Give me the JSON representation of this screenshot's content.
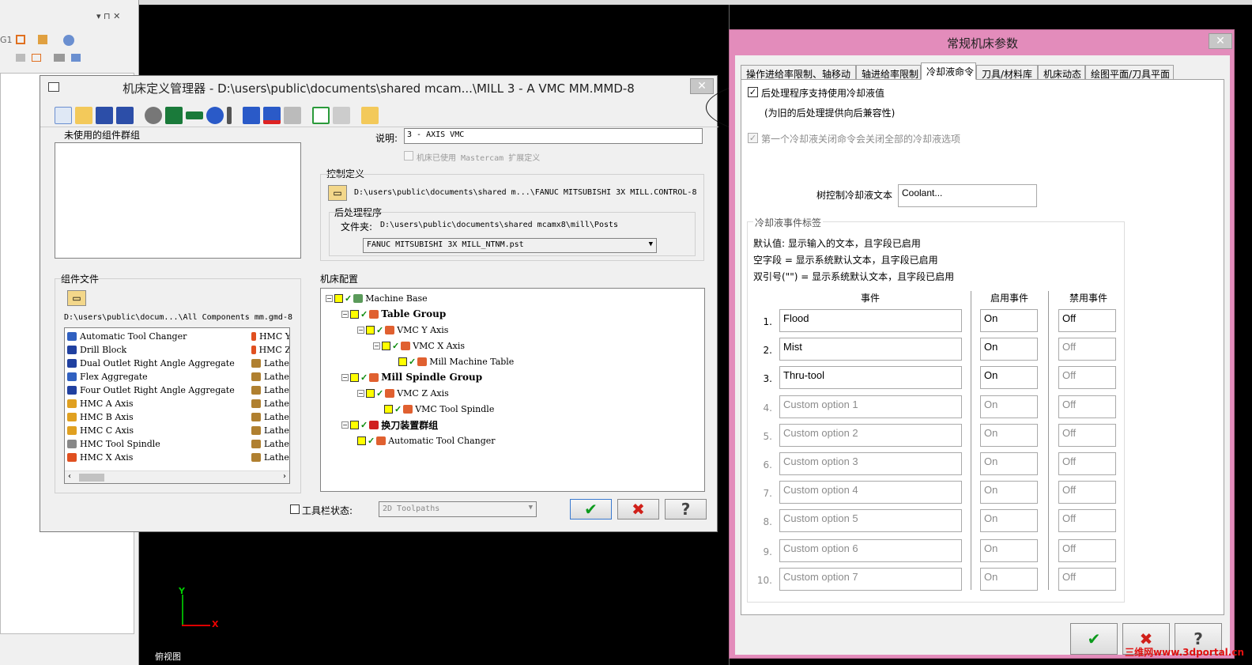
{
  "bg_left": {
    "tools_row1": "G1",
    "bottom_view_label": "俯视图",
    "axis_x": "X",
    "axis_y": "Y"
  },
  "manager": {
    "title": "机床定义管理器 - D:\\users\\public\\documents\\shared mcam...\\MILL 3 - A VMC MM.MMD-8",
    "unused_groups_label": "未使用的组件群组",
    "desc_label": "说明:",
    "desc_value": "3 - AXIS VMC",
    "ext_def_label": "机床已使用 Mastercam 扩展定义",
    "control_def_label": "控制定义",
    "control_path": "D:\\users\\public\\documents\\shared m...\\FANUC MITSUBISHI 3X MILL.CONTROL-8",
    "post_label": "后处理程序",
    "folder_label": "文件夹:",
    "folder_path": "D:\\users\\public\\documents\\shared mcamx8\\mill\\Posts",
    "post_select": "FANUC MITSUBISHI 3X MILL_NTNM.pst",
    "component_file_label": "组件文件",
    "component_path": "D:\\users\\public\\docum...\\All Components mm.gmd-8",
    "components_left": [
      "Automatic Tool Changer",
      "Drill Block",
      "Dual Outlet Right Angle Aggregate",
      "Flex Aggregate",
      "Four Outlet Right Angle Aggregate",
      "HMC A Axis",
      "HMC B Axis",
      "HMC C Axis",
      "HMC Tool Spindle",
      "HMC X Axis"
    ],
    "components_right": [
      "HMC Y",
      "HMC Z",
      "Lathe",
      "Lathe",
      "Lathe",
      "Lathe",
      "Lathe",
      "Lathe",
      "Lathe",
      "Lathe"
    ],
    "machine_config_label": "机床配置",
    "tree": [
      "Machine Base",
      "Table Group",
      "VMC Y Axis",
      "VMC X Axis",
      "Mill Machine Table",
      "Mill Spindle Group",
      "VMC Z Axis",
      "VMC Tool Spindle",
      "换刀装置群组",
      "Automatic Tool Changer"
    ],
    "toolbar_state_label": "工具栏状态:",
    "toolbar_state_value": "2D Toolpaths",
    "close_glyph": "✕",
    "ok_glyph": "✔",
    "cancel_glyph": "✖",
    "help_glyph": "?"
  },
  "dialog": {
    "title": "常规机床参数",
    "close_glyph": "✕",
    "tabs": [
      "操作进给率限制、轴移动",
      "轴进给率限制",
      "冷却液命令",
      "刀具/材料库",
      "机床动态",
      "绘图平面/刀具平面"
    ],
    "active_tab": "冷却液命令",
    "check1_label": "后处理程序支持使用冷却液值",
    "check1_note": "(为旧的后处理提供向后兼容性)",
    "check2_label": "第一个冷却液关闭命令会关闭全部的冷却液选项",
    "tree_text_label": "树控制冷却液文本",
    "tree_text_value": "Coolant...",
    "event_group_label": "冷却液事件标签",
    "info1": "默认值: 显示输入的文本，且字段已启用",
    "info2": "空字段 = 显示系统默认文本，且字段已启用",
    "info3": "双引号(\"\") = 显示系统默认文本，且字段已启用",
    "col_event": "事件",
    "col_enable": "启用事件",
    "col_disable": "禁用事件",
    "rows": [
      {
        "num": "1.",
        "event": "Flood",
        "on": "On",
        "off": "Off",
        "active": true
      },
      {
        "num": "2.",
        "event": "Mist",
        "on": "On",
        "off": "Off",
        "active": true
      },
      {
        "num": "3.",
        "event": "Thru-tool",
        "on": "On",
        "off": "Off",
        "active": true
      },
      {
        "num": "4.",
        "event": "Custom option 1",
        "on": "On",
        "off": "Off",
        "active": false
      },
      {
        "num": "5.",
        "event": "Custom option 2",
        "on": "On",
        "off": "Off",
        "active": false
      },
      {
        "num": "6.",
        "event": "Custom option 3",
        "on": "On",
        "off": "Off",
        "active": false
      },
      {
        "num": "7.",
        "event": "Custom option 4",
        "on": "On",
        "off": "Off",
        "active": false
      },
      {
        "num": "8.",
        "event": "Custom option 5",
        "on": "On",
        "off": "Off",
        "active": false
      },
      {
        "num": "9.",
        "event": "Custom option 6",
        "on": "On",
        "off": "Off",
        "active": false
      },
      {
        "num": "10.",
        "event": "Custom option 7",
        "on": "On",
        "off": "Off",
        "active": false
      }
    ],
    "ok_glyph": "✔",
    "cancel_glyph": "✖",
    "help_glyph": "?"
  },
  "watermark": "三维网www.3dportal.cn"
}
